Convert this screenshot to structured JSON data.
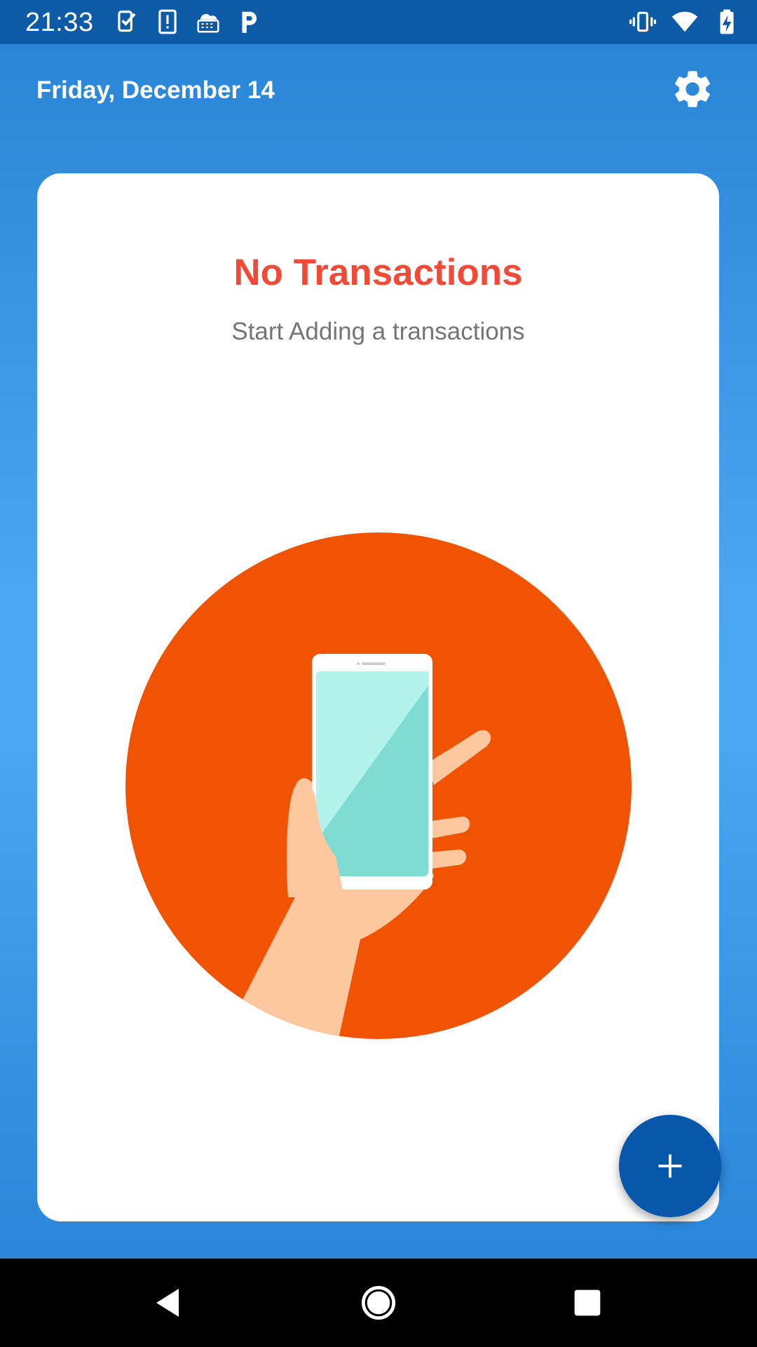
{
  "status_bar": {
    "time": "21:33",
    "left_icons": [
      "task-check-icon",
      "alert-notification-icon",
      "keyboard-test-icon",
      "parking-p-icon"
    ],
    "right_icons": [
      "vibrate-icon",
      "wifi-icon",
      "battery-charging-icon"
    ]
  },
  "header": {
    "date": "Friday, December 14",
    "settings_icon": "gear-icon"
  },
  "empty_state": {
    "title": "No Transactions",
    "subtitle": "Start Adding a transactions",
    "illustration": "hand-holding-phone"
  },
  "fab": {
    "icon": "plus-icon"
  },
  "nav_bar": {
    "icons": [
      "back-icon",
      "home-icon",
      "recents-icon"
    ]
  },
  "colors": {
    "status_bar": "#0d5aa7",
    "accent_red": "#f04b37",
    "illustration_circle": "#f05403",
    "fab": "#0758aa",
    "subtitle_gray": "#757575"
  }
}
